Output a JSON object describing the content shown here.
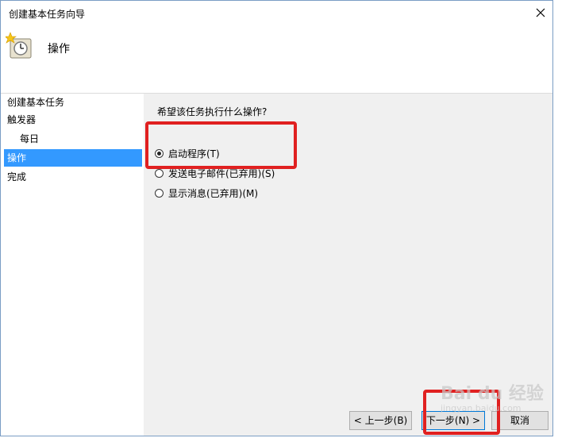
{
  "window": {
    "title": "创建基本任务向导",
    "close_glyph": "✕"
  },
  "header": {
    "heading": "操作"
  },
  "sidebar": {
    "items": [
      {
        "label": "创建基本任务"
      },
      {
        "label": "触发器"
      },
      {
        "label": "每日"
      },
      {
        "label": "操作"
      },
      {
        "label": "完成"
      }
    ]
  },
  "main": {
    "question": "希望该任务执行什么操作?",
    "options": [
      {
        "label": "启动程序(T)",
        "checked": true
      },
      {
        "label": "发送电子邮件(已弃用)(S)",
        "checked": false
      },
      {
        "label": "显示消息(已弃用)(M)",
        "checked": false
      }
    ]
  },
  "buttons": {
    "back": "< 上一步(B)",
    "next": "下一步(N) >",
    "cancel": "取消"
  },
  "watermark": {
    "brand": "Bai du 经验",
    "sub": "jingyan.baidu.com"
  },
  "colors": {
    "selection": "#3399ff",
    "annotation": "#e02020"
  }
}
